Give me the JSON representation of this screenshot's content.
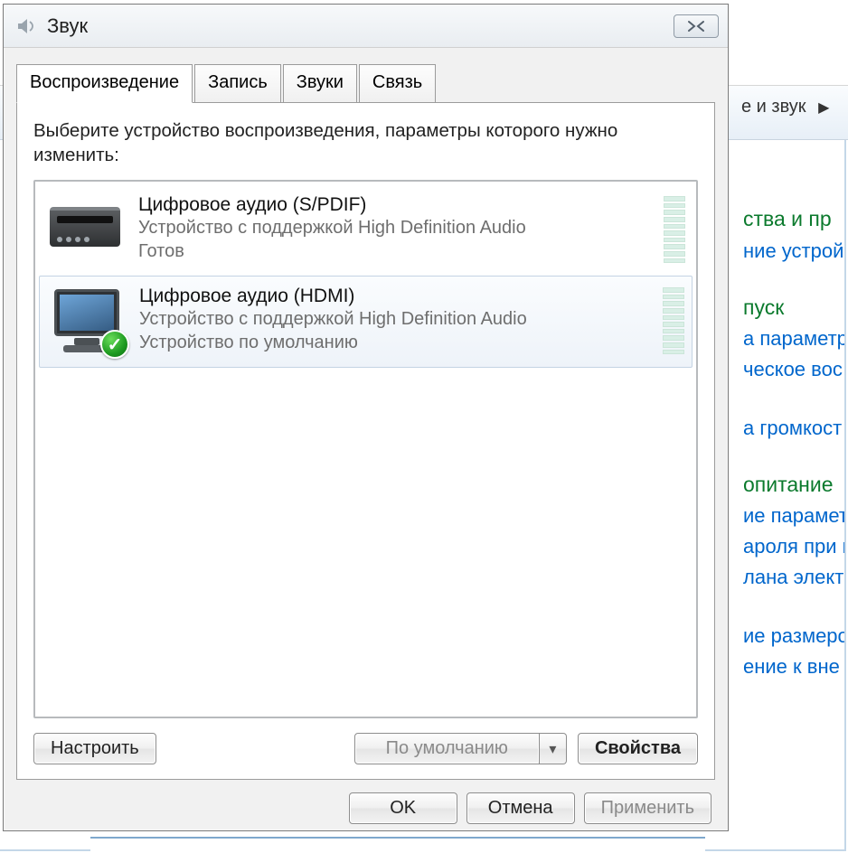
{
  "background": {
    "address_fragment": "е и звук",
    "sections": [
      {
        "heading": "ства и пр",
        "links": [
          "ние устройс"
        ]
      },
      {
        "heading": "пуск",
        "links": [
          "а параметр",
          "ческое вос"
        ]
      },
      {
        "heading": "",
        "links": [
          "а громкост"
        ]
      },
      {
        "heading": "опитание",
        "links": [
          "ие параметр",
          "ароля при в",
          "лана электр"
        ]
      },
      {
        "heading": "",
        "links": [
          "ие размеро",
          "ение к вне"
        ]
      }
    ]
  },
  "dialog": {
    "title": "Звук",
    "tabs": [
      "Воспроизведение",
      "Запись",
      "Звуки",
      "Связь"
    ],
    "active_tab": 0,
    "instruction": "Выберите устройство воспроизведения, параметры которого нужно изменить:",
    "devices": [
      {
        "title": "Цифровое аудио (S/PDIF)",
        "desc": "Устройство с поддержкой High Definition Audio",
        "status": "Готов",
        "default": false
      },
      {
        "title": "Цифровое аудио (HDMI)",
        "desc": "Устройство с поддержкой High Definition Audio",
        "status": "Устройство по умолчанию",
        "default": true
      }
    ],
    "selected_device_index": 1,
    "buttons": {
      "configure": "Настроить",
      "set_default": "По умолчанию",
      "properties": "Свойства",
      "ok": "OK",
      "cancel": "Отмена",
      "apply": "Применить"
    }
  }
}
